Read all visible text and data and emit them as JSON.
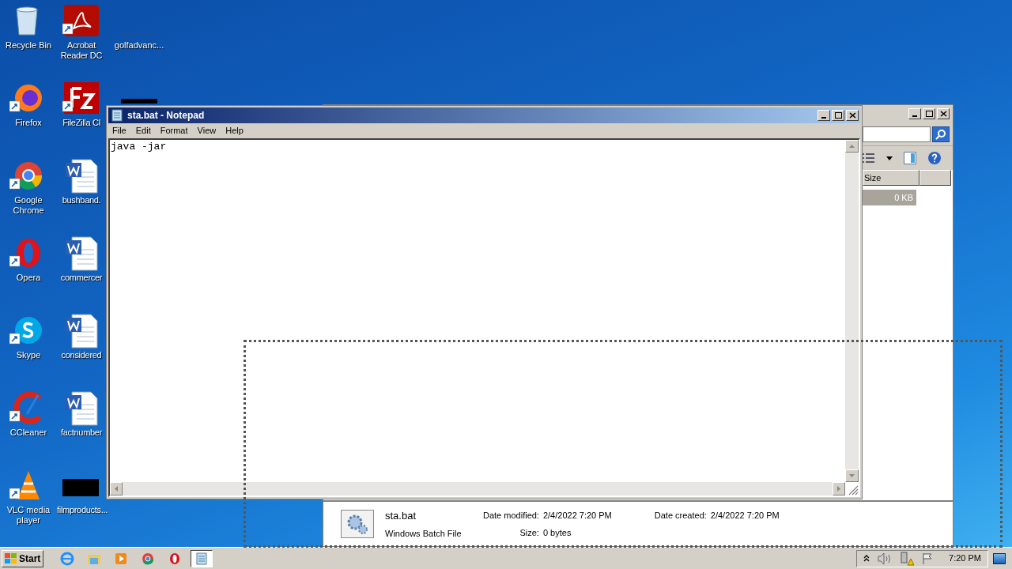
{
  "desktop": {
    "columns": [
      [
        {
          "label": "Recycle Bin",
          "kind": "recycle"
        },
        {
          "label": "Firefox",
          "kind": "firefox"
        },
        {
          "label": "Google Chrome",
          "kind": "chrome"
        },
        {
          "label": "Opera",
          "kind": "opera"
        },
        {
          "label": "Skype",
          "kind": "skype"
        },
        {
          "label": "CCleaner",
          "kind": "ccleaner"
        },
        {
          "label": "VLC media player",
          "kind": "vlc"
        }
      ],
      [
        {
          "label": "Acrobat Reader DC",
          "kind": "acrobat"
        },
        {
          "label": "FileZilla Cl",
          "kind": "filezilla"
        },
        {
          "label": "bushband.",
          "kind": "word"
        },
        {
          "label": "commercer",
          "kind": "word"
        },
        {
          "label": "considered",
          "kind": "word"
        },
        {
          "label": "factnumber",
          "kind": "word"
        },
        {
          "label": "filmproducts...",
          "kind": "thumbnail"
        }
      ],
      [
        {
          "label": "golfadvanc...",
          "kind": "blank"
        },
        {
          "kind": "thumbnail"
        }
      ]
    ]
  },
  "explorer": {
    "columns": [
      "Size"
    ],
    "rows": [
      {
        "size": "0 KB",
        "selected": true
      }
    ],
    "details": {
      "name": "sta.bat",
      "type": "Windows Batch File",
      "fields": [
        {
          "label": "Date modified:",
          "value": "2/4/2022 7:20 PM"
        },
        {
          "label": "Size:",
          "value": "0 bytes"
        },
        {
          "label": "Date created:",
          "value": "2/4/2022 7:20 PM"
        }
      ]
    }
  },
  "notepad": {
    "title": "sta.bat - Notepad",
    "menu": [
      "File",
      "Edit",
      "Format",
      "View",
      "Help"
    ],
    "text": "java -jar"
  },
  "taskbar": {
    "start": "Start",
    "apps": [
      {
        "kind": "ie",
        "active": false
      },
      {
        "kind": "folder",
        "active": false
      },
      {
        "kind": "media",
        "active": false
      },
      {
        "kind": "chrome",
        "active": false
      },
      {
        "kind": "opera",
        "active": false
      },
      {
        "kind": "notepad",
        "active": true
      }
    ],
    "clock": "7:20 PM"
  }
}
